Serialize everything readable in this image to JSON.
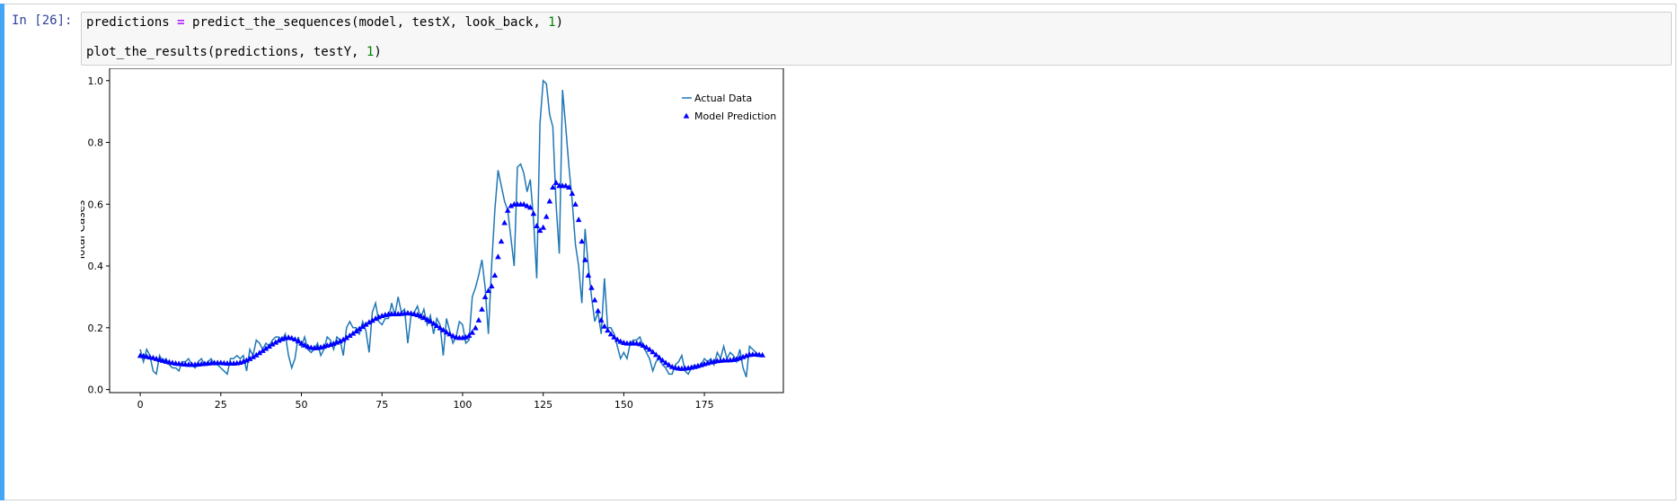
{
  "cell": {
    "prompt": "In [26]:",
    "code": {
      "line1": {
        "var": "predictions",
        "op": "=",
        "call": " predict_the_sequences(model, testX, look_back, ",
        "num": "1",
        "close": ")"
      },
      "line2": {
        "call": "plot_the_results(predictions, testY, ",
        "num": "1",
        "close": ")"
      }
    }
  },
  "chart_data": {
    "type": "line",
    "title": "",
    "xlabel": "",
    "ylabel": "Total Cases",
    "xlim": [
      -9.5,
      199.5
    ],
    "ylim": [
      -0.01,
      1.04
    ],
    "xticks": [
      0,
      25,
      50,
      75,
      100,
      125,
      150,
      175
    ],
    "yticks": [
      0.0,
      0.2,
      0.4,
      0.6,
      0.8,
      1.0
    ],
    "legend": {
      "position": "top-right",
      "entries": [
        "Actual Data",
        "Model Prediction"
      ]
    },
    "series": [
      {
        "name": "Actual Data",
        "style": "line",
        "color": "#1f77b4",
        "values": [
          0.13,
          0.09,
          0.13,
          0.11,
          0.06,
          0.05,
          0.11,
          0.09,
          0.1,
          0.08,
          0.07,
          0.07,
          0.06,
          0.09,
          0.09,
          0.1,
          0.08,
          0.07,
          0.09,
          0.1,
          0.08,
          0.09,
          0.1,
          0.08,
          0.08,
          0.07,
          0.06,
          0.05,
          0.1,
          0.1,
          0.11,
          0.1,
          0.11,
          0.06,
          0.13,
          0.11,
          0.16,
          0.15,
          0.13,
          0.15,
          0.14,
          0.16,
          0.17,
          0.17,
          0.16,
          0.18,
          0.11,
          0.07,
          0.1,
          0.17,
          0.14,
          0.17,
          0.13,
          0.12,
          0.13,
          0.15,
          0.11,
          0.13,
          0.17,
          0.16,
          0.13,
          0.17,
          0.16,
          0.11,
          0.2,
          0.22,
          0.2,
          0.2,
          0.18,
          0.22,
          0.19,
          0.12,
          0.25,
          0.28,
          0.22,
          0.21,
          0.23,
          0.23,
          0.28,
          0.24,
          0.3,
          0.25,
          0.26,
          0.15,
          0.24,
          0.25,
          0.27,
          0.23,
          0.26,
          0.21,
          0.24,
          0.18,
          0.23,
          0.21,
          0.11,
          0.23,
          0.19,
          0.15,
          0.17,
          0.22,
          0.21,
          0.15,
          0.16,
          0.3,
          0.33,
          0.37,
          0.42,
          0.33,
          0.18,
          0.4,
          0.58,
          0.71,
          0.66,
          0.61,
          0.58,
          0.49,
          0.4,
          0.72,
          0.73,
          0.7,
          0.64,
          0.68,
          0.55,
          0.36,
          0.86,
          1.0,
          0.99,
          0.89,
          0.85,
          0.6,
          0.44,
          0.97,
          0.85,
          0.72,
          0.61,
          0.47,
          0.4,
          0.28,
          0.52,
          0.4,
          0.3,
          0.22,
          0.25,
          0.18,
          0.36,
          0.2,
          0.2,
          0.18,
          0.14,
          0.1,
          0.12,
          0.1,
          0.15,
          0.16,
          0.16,
          0.17,
          0.14,
          0.12,
          0.1,
          0.06,
          0.09,
          0.1,
          0.08,
          0.07,
          0.05,
          0.05,
          0.08,
          0.09,
          0.11,
          0.06,
          0.05,
          0.07,
          0.08,
          0.07,
          0.08,
          0.1,
          0.09,
          0.1,
          0.08,
          0.12,
          0.1,
          0.14,
          0.1,
          0.12,
          0.11,
          0.09,
          0.13,
          0.07,
          0.04,
          0.14,
          0.13,
          0.12,
          0.11
        ]
      },
      {
        "name": "Model Prediction",
        "style": "markers",
        "marker": "triangle",
        "color": "#0000ff",
        "values": [
          0.11,
          0.109,
          0.107,
          0.105,
          0.103,
          0.1,
          0.097,
          0.094,
          0.091,
          0.089,
          0.087,
          0.085,
          0.084,
          0.083,
          0.082,
          0.081,
          0.081,
          0.081,
          0.082,
          0.083,
          0.084,
          0.085,
          0.086,
          0.087,
          0.087,
          0.087,
          0.086,
          0.085,
          0.085,
          0.085,
          0.086,
          0.088,
          0.091,
          0.095,
          0.1,
          0.106,
          0.112,
          0.119,
          0.126,
          0.133,
          0.14,
          0.147,
          0.153,
          0.159,
          0.164,
          0.167,
          0.169,
          0.167,
          0.163,
          0.157,
          0.15,
          0.144,
          0.139,
          0.136,
          0.135,
          0.135,
          0.137,
          0.14,
          0.143,
          0.146,
          0.149,
          0.153,
          0.157,
          0.162,
          0.168,
          0.175,
          0.182,
          0.189,
          0.197,
          0.204,
          0.211,
          0.218,
          0.224,
          0.23,
          0.235,
          0.239,
          0.242,
          0.244,
          0.245,
          0.245,
          0.245,
          0.246,
          0.247,
          0.248,
          0.247,
          0.245,
          0.242,
          0.238,
          0.233,
          0.227,
          0.221,
          0.214,
          0.207,
          0.2,
          0.193,
          0.186,
          0.18,
          0.174,
          0.17,
          0.168,
          0.168,
          0.17,
          0.175,
          0.185,
          0.2,
          0.225,
          0.26,
          0.3,
          0.32,
          0.335,
          0.37,
          0.43,
          0.48,
          0.54,
          0.58,
          0.595,
          0.6,
          0.6,
          0.6,
          0.6,
          0.595,
          0.59,
          0.57,
          0.53,
          0.515,
          0.525,
          0.56,
          0.61,
          0.655,
          0.67,
          0.66,
          0.66,
          0.66,
          0.655,
          0.635,
          0.6,
          0.55,
          0.48,
          0.42,
          0.37,
          0.33,
          0.29,
          0.255,
          0.225,
          0.205,
          0.192,
          0.18,
          0.17,
          0.162,
          0.156,
          0.152,
          0.15,
          0.15,
          0.15,
          0.15,
          0.148,
          0.143,
          0.137,
          0.13,
          0.122,
          0.113,
          0.104,
          0.095,
          0.087,
          0.08,
          0.074,
          0.071,
          0.069,
          0.068,
          0.069,
          0.07,
          0.072,
          0.074,
          0.077,
          0.08,
          0.083,
          0.086,
          0.089,
          0.091,
          0.093,
          0.094,
          0.095,
          0.095,
          0.096,
          0.097,
          0.099,
          0.102,
          0.106,
          0.11,
          0.113,
          0.114,
          0.114,
          0.113,
          0.112
        ]
      }
    ]
  }
}
